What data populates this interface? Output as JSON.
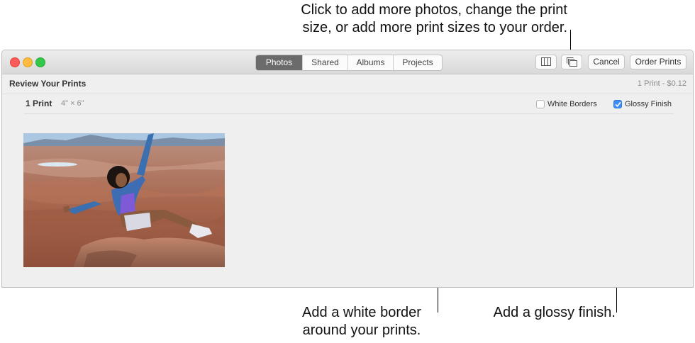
{
  "callouts": {
    "top_line1": "Click to add more photos, change the print",
    "top_line2": "size, or add more print sizes to your order.",
    "border_line1": "Add a white border",
    "border_line2": "around your prints.",
    "glossy": "Add a glossy finish."
  },
  "window": {
    "tabs": [
      {
        "label": "Photos",
        "active": true
      },
      {
        "label": "Shared",
        "active": false
      },
      {
        "label": "Albums",
        "active": false
      },
      {
        "label": "Projects",
        "active": false
      }
    ],
    "toolbar": {
      "sidebar_icon": "sidebar-toggle-icon",
      "stack_icon": "add-photos-stack-icon",
      "cancel_label": "Cancel",
      "order_label": "Order Prints"
    }
  },
  "review": {
    "title": "Review Your Prints",
    "total": "1 Print - $0.12"
  },
  "print_item": {
    "count": "1 Print",
    "size": "4\" × 6\"",
    "white_borders": {
      "label": "White Borders",
      "checked": false
    },
    "glossy_finish": {
      "label": "Glossy Finish",
      "checked": true
    }
  },
  "colors": {
    "accent": "#3d8ef5",
    "segment_active": "#6b6b6b"
  }
}
